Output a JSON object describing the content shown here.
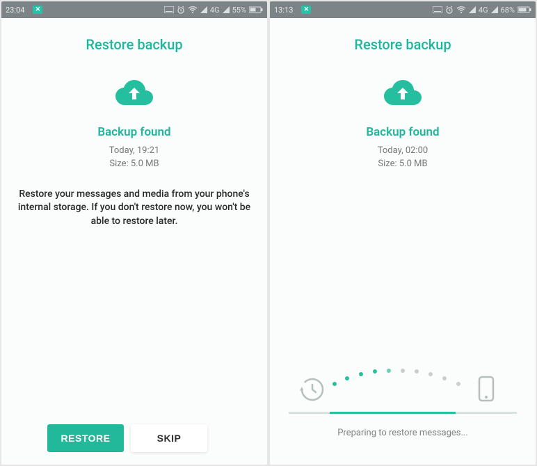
{
  "colors": {
    "accent": "#1fb79c",
    "primary_btn": "#21b99a"
  },
  "left": {
    "statusbar": {
      "time": "23:04",
      "network": "4G",
      "battery": "55%"
    },
    "title": "Restore backup",
    "cloud_icon": "cloud-upload-icon",
    "subtitle": "Backup found",
    "meta_line1": "Today, 19:21",
    "meta_line2": "Size: 5.0 MB",
    "description": "Restore your messages and media from your phone's internal storage. If you don't restore now, you won't be able to restore later.",
    "restore_label": "RESTORE",
    "skip_label": "SKIP"
  },
  "right": {
    "statusbar": {
      "time": "13:13",
      "network": "4G",
      "battery": "68%"
    },
    "title": "Restore backup",
    "cloud_icon": "cloud-upload-icon",
    "subtitle": "Backup found",
    "meta_line1": "Today, 02:00",
    "meta_line2": "Size: 5.0 MB",
    "status_text": "Preparing to restore messages..."
  }
}
